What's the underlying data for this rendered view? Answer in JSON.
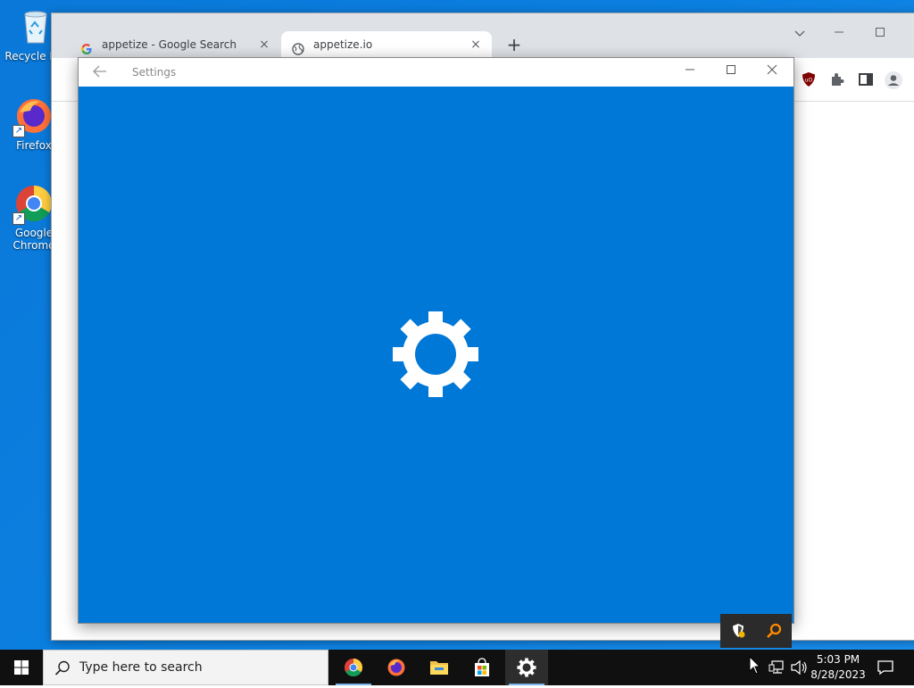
{
  "desktop": {
    "icons": [
      {
        "label": "Recycle Bin",
        "icon": "recycle-bin-icon"
      },
      {
        "label": "Firefox",
        "icon": "firefox-icon"
      },
      {
        "label": "Google Chrome",
        "icon": "chrome-icon"
      }
    ]
  },
  "browser": {
    "tabs": [
      {
        "title": "appetize - Google Search",
        "icon": "google-icon",
        "close": "×"
      },
      {
        "title": "appetize.io",
        "icon": "globe-icon",
        "close": "×"
      }
    ],
    "new_tab": "+"
  },
  "settings_window": {
    "title": "Settings",
    "accent": "#0078d7",
    "splash_icon": "gear-icon"
  },
  "taskbar": {
    "search_placeholder": "Type here to search",
    "apps": [
      "chrome-icon",
      "firefox-icon",
      "file-explorer-icon",
      "store-icon",
      "settings-icon"
    ],
    "time": "5:03 PM",
    "date": "8/28/2023"
  }
}
